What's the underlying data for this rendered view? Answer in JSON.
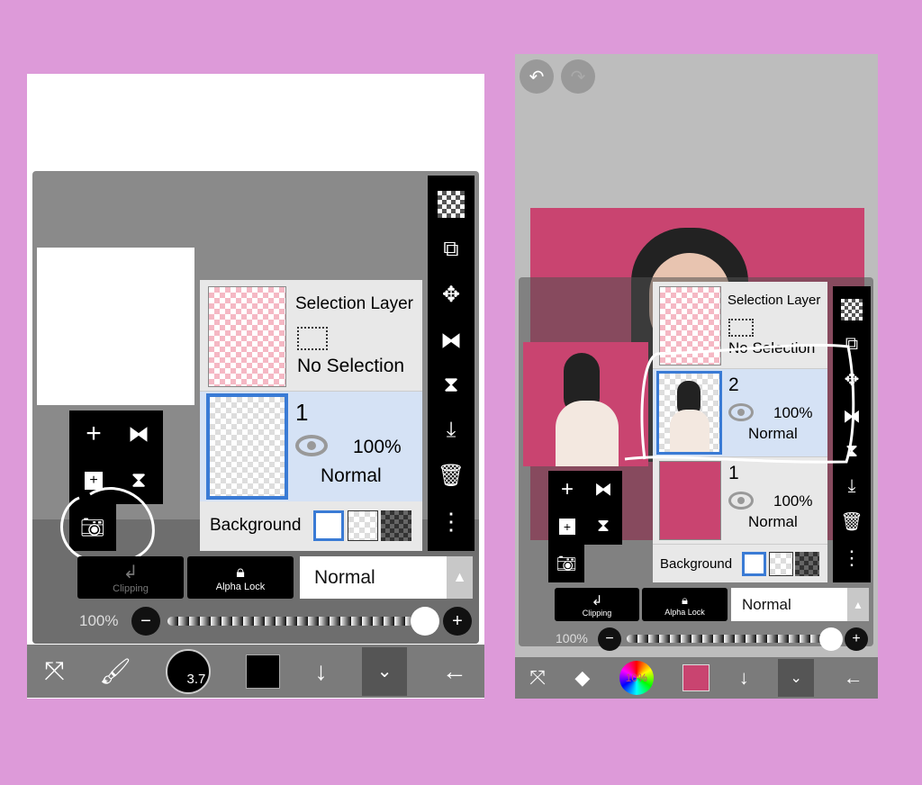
{
  "left": {
    "layers": [
      {
        "title": "Selection Layer",
        "status": "No Selection"
      },
      {
        "number": "1",
        "opacity": "100%",
        "blend": "Normal"
      }
    ],
    "background_label": "Background",
    "clipping_label": "Clipping",
    "alpha_lock_label": "Alpha Lock",
    "blend_mode": "Normal",
    "opacity_label": "100%",
    "brush_size": "3.7",
    "color": "#000000"
  },
  "right": {
    "layers": [
      {
        "title": "Selection Layer",
        "status": "No Selection"
      },
      {
        "number": "2",
        "opacity": "100%",
        "blend": "Normal"
      },
      {
        "number": "1",
        "opacity": "100%",
        "blend": "Normal"
      }
    ],
    "background_label": "Background",
    "clipping_label": "Clipping",
    "alpha_lock_label": "Alpha Lock",
    "blend_mode": "Normal",
    "opacity_label": "100%",
    "color_wheel_label": "10%",
    "color": "#c94470"
  },
  "colors": {
    "page_bg": "#dd9ad9",
    "selected_layer": "#d5e2f5",
    "accent_blue": "#3a7bd5",
    "pink": "#c94470"
  }
}
